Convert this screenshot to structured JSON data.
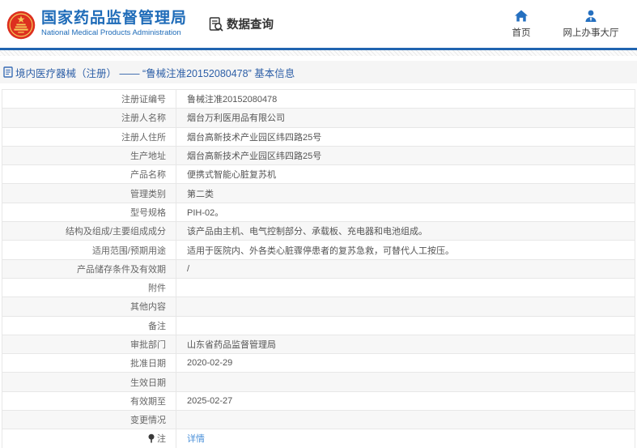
{
  "header": {
    "title": "国家药品监督管理局",
    "subtitle": "National Medical Products Administration",
    "data_query_label": "数据查询",
    "nav": [
      {
        "label": "首页",
        "icon": "home-icon"
      },
      {
        "label": "网上办事大厅",
        "icon": "user-icon"
      }
    ]
  },
  "breadcrumb": {
    "text": "境内医疗器械（注册） ——  “鲁械注准20152080478”  基本信息"
  },
  "table": {
    "rows": [
      {
        "label": "注册证编号",
        "value": "鲁械注准20152080478"
      },
      {
        "label": "注册人名称",
        "value": "烟台万利医用品有限公司"
      },
      {
        "label": "注册人住所",
        "value": "烟台高新技术产业园区纬四路25号"
      },
      {
        "label": "生产地址",
        "value": "烟台高新技术产业园区纬四路25号"
      },
      {
        "label": "产品名称",
        "value": "便携式智能心脏复苏机"
      },
      {
        "label": "管理类别",
        "value": "第二类"
      },
      {
        "label": "型号规格",
        "value": "PIH-02。"
      },
      {
        "label": "结构及组成/主要组成成分",
        "value": "该产品由主机、电气控制部分、承载板、充电器和电池组成。"
      },
      {
        "label": "适用范围/预期用途",
        "value": "适用于医院内、外各类心脏骤停患者的复苏急救，可替代人工按压。"
      },
      {
        "label": "产品储存条件及有效期",
        "value": "/"
      },
      {
        "label": "附件",
        "value": ""
      },
      {
        "label": "其他内容",
        "value": ""
      },
      {
        "label": "备注",
        "value": ""
      },
      {
        "label": "审批部门",
        "value": "山东省药品监督管理局"
      },
      {
        "label": "批准日期",
        "value": "2020-02-29"
      },
      {
        "label": "生效日期",
        "value": ""
      },
      {
        "label": "有效期至",
        "value": "2025-02-27"
      },
      {
        "label": "变更情况",
        "value": ""
      },
      {
        "label": "注",
        "value": "详情",
        "link": true,
        "icon": "pin-icon"
      }
    ]
  },
  "colors": {
    "brand_blue": "#1e6bb8",
    "header_border": "#2064b0",
    "breadcrumb_text": "#2d5fa7",
    "link_blue": "#4a90d9",
    "emblem_red": "#dd2f1f",
    "emblem_gold": "#f5c858"
  }
}
